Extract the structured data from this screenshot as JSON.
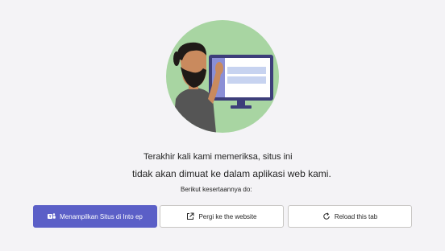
{
  "message": {
    "line1": "Terakhir kali kami memeriksa, situs ini",
    "line2": "tidak akan dimuat ke dalam aplikasi web kami.",
    "line3": "Berikut kesertaannya do:"
  },
  "buttons": {
    "show_in_app": {
      "label": "Menampilkan Situs di Into ep",
      "icon": "teams-icon"
    },
    "go_to_website": {
      "label": "Pergi ke the website",
      "icon": "external-link-icon"
    },
    "reload_tab": {
      "label": "Reload this tab",
      "icon": "reload-icon"
    }
  },
  "colors": {
    "primary": "#5b5fc7",
    "background": "#f4f3f6",
    "illustration_circle": "#a8d5a2"
  }
}
